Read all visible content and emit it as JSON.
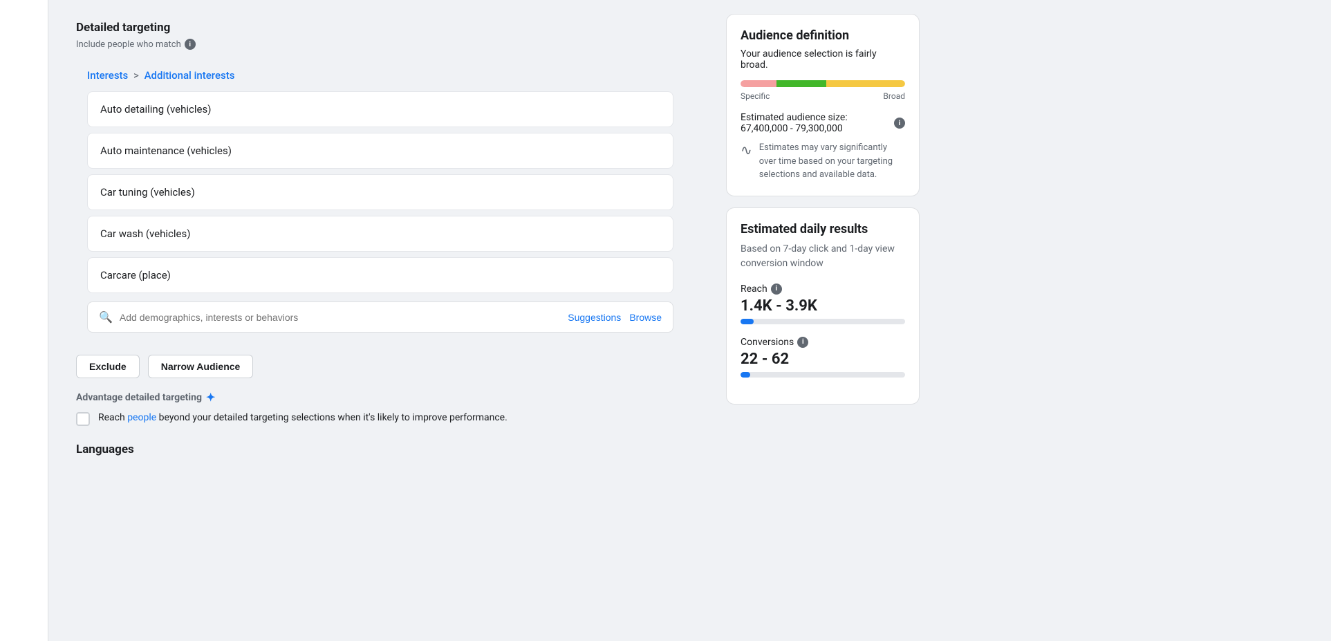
{
  "page": {
    "title": "Detailed targeting",
    "subtitle": "Include people who match"
  },
  "breadcrumb": {
    "interests": "Interests",
    "separator": ">",
    "additional": "Additional interests"
  },
  "interests": [
    {
      "label": "Auto detailing (vehicles)"
    },
    {
      "label": "Auto maintenance (vehicles)"
    },
    {
      "label": "Car tuning (vehicles)"
    },
    {
      "label": "Car wash (vehicles)"
    },
    {
      "label": "Carcare (place)"
    }
  ],
  "search": {
    "placeholder": "Add demographics, interests or behaviors",
    "suggestions_label": "Suggestions",
    "browse_label": "Browse"
  },
  "buttons": {
    "exclude": "Exclude",
    "narrow_audience": "Narrow Audience"
  },
  "advantage": {
    "title": "Advantage detailed targeting",
    "text_before": "Reach ",
    "link_text": "people",
    "text_after": " beyond your detailed targeting selections when it's likely to improve performance."
  },
  "languages": {
    "title": "Languages"
  },
  "audience_definition": {
    "card_title": "Audience definition",
    "description": "Your audience selection is fairly broad.",
    "meter_label_left": "Specific",
    "meter_label_right": "Broad",
    "size_text": "Estimated audience size: 67,400,000 - 79,300,000",
    "estimates_text": "Estimates may vary significantly over time based on your targeting selections and available data."
  },
  "daily_results": {
    "card_title": "Estimated daily results",
    "description": "Based on 7-day click and 1-day view conversion window",
    "reach_label": "Reach",
    "reach_value": "1.4K - 3.9K",
    "reach_bar_percent": 8,
    "conversions_label": "Conversions",
    "conversions_value": "22 - 62",
    "conversions_bar_percent": 6
  }
}
